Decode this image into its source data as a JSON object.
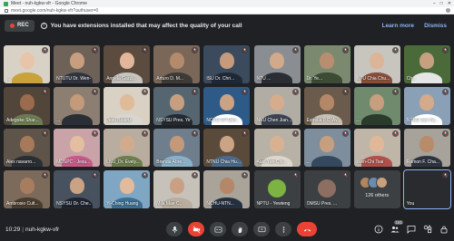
{
  "browser": {
    "title": "Meet - nuh-kgkw-vfr - Google Chrome",
    "url": "meet.google.com/nuh-kgkw-vfr?authuser=0"
  },
  "banner": {
    "rec_label": "REC",
    "warning": "You have extensions installed that may affect the quality of your call",
    "learn_more": "Learn more",
    "dismiss": "Dismiss"
  },
  "participants": [
    {
      "name": "...",
      "face": "#e8c4a8",
      "bg": "#d8d2c6",
      "body": "#c9a23b"
    },
    {
      "name": "NTUTU Dr. Wen-...",
      "face": "#c79e80",
      "bg": "#6e6258",
      "body": "#2f3440"
    },
    {
      "name": "Angela Garzi...",
      "face": "#e2b69a",
      "bg": "#5b4c3f",
      "body": "#c7c3bd"
    },
    {
      "name": "Arturo D. M...",
      "face": "#b38a6c",
      "bg": "#7a6757",
      "body": "#3e3a36"
    },
    {
      "name": "ISU Dr. Chri...",
      "face": "#c69a7c",
      "bg": "#3b4a5c",
      "body": "#1f2835"
    },
    {
      "name": "NTU ...",
      "face": "#d1a98b",
      "bg": "#8a8d91",
      "body": "#2a2d33"
    },
    {
      "name": "Dr. Ye...",
      "face": "#b98e70",
      "bg": "#7b8a6e",
      "body": "#3c4b33"
    },
    {
      "name": "NTU Chia Chu...",
      "face": "#dcb498",
      "bg": "#c8c5bf",
      "body": "#8a4d3a"
    },
    {
      "name": "Ch...",
      "face": "#c7a080",
      "bg": "#4a6a3a",
      "body": "#e6e6e6"
    },
    {
      "name": "Adegoke Shar...",
      "face": "#9a6b4c",
      "bg": "#52463a",
      "body": "#6c7b53"
    },
    {
      "name": "...",
      "face": "#c39a7a",
      "bg": "#8c7f72",
      "body": "#2a2e35"
    },
    {
      "name": "Jesu Beatriz",
      "face": "#e0bb9a",
      "bg": "#d9d1c4",
      "body": "#d9d6cf"
    },
    {
      "name": "NSYSU Pres. Yin...",
      "face": "#c79f80",
      "bg": "#556670",
      "body": "#242a31"
    },
    {
      "name": "NCYU VP Den...",
      "face": "#caa284",
      "bg": "#2e5a88",
      "body": "#ffffff"
    },
    {
      "name": "NKU Chen Jian...",
      "face": "#d5ac8c",
      "bg": "#b1aca4",
      "body": "#3b4350"
    },
    {
      "name": "Estrella P.C. Ay...",
      "face": "#b48867",
      "bg": "#6a5b4c",
      "body": "#c8bfb3"
    },
    {
      "name": "...",
      "face": "#c79e7e",
      "bg": "#6f8a6c",
      "body": "#2a3a2b"
    },
    {
      "name": "NTNU Jun-Ya...",
      "face": "#d3aa8a",
      "bg": "#8aa0b6",
      "body": "#ffffff"
    },
    {
      "name": "Alex navarro...",
      "face": "#a5795a",
      "bg": "#5e544a",
      "body": "#2b2e33"
    },
    {
      "name": "MDSPC - Jesu...",
      "face": "#e3bea0",
      "bg": "#c9a3a8",
      "body": "#c45a88"
    },
    {
      "name": "LNU_Dr. Evely...",
      "face": "#d2ab8f",
      "bg": "#b8ad9e",
      "body": "#6d7d4e"
    },
    {
      "name": "Brenda Abre...",
      "face": "#c4997a",
      "bg": "#6f7e8d",
      "body": "#8ab0c8"
    },
    {
      "name": "NTNU Chia Hu...",
      "face": "#cba385",
      "bg": "#5a4a3a",
      "body": "#4b6a8a"
    },
    {
      "name": "Alan Yen-Chi...",
      "face": "#d8b193",
      "bg": "#b7b1a6",
      "body": "#dcd6cc"
    },
    {
      "name": "...",
      "face": "#c69f7f",
      "bg": "#7f8e9c",
      "body": "#34495e"
    },
    {
      "name": "Wen-Chi Tsai",
      "face": "#e0b898",
      "bg": "#c0b6a8",
      "body": "#b0504a"
    },
    {
      "name": "Ramon F. Cha...",
      "face": "#b88b6a",
      "bg": "#a7a29a",
      "body": "#2d3440"
    },
    {
      "name": "Ambrosio Cult...",
      "face": "#a87c5e",
      "bg": "#7c6b5a",
      "body": "#4a3c2e"
    },
    {
      "name": "NSYSU Dr. Che...",
      "face": "#caa385",
      "bg": "#47525e",
      "body": "#1f2530"
    },
    {
      "name": "Yi-Ching Huang",
      "face": "#e1bb9c",
      "bg": "#7fa7c4",
      "body": "#3d6f93"
    },
    {
      "name": "Mila Mae C...",
      "face": "#c9a083",
      "bg": "#c6c2ba",
      "body": "#b9ad9d"
    },
    {
      "name": "NCHU-NTN...",
      "face": "#b48768",
      "bg": "#a9a39a",
      "body": "#243040"
    }
  ],
  "avatar_tiles": [
    {
      "name": "NPTU - Yewteng ...",
      "color": "#7cb342"
    },
    {
      "name": "OMSU Pres. ...",
      "color": "#8d6e63"
    }
  ],
  "others": {
    "label": "126 others"
  },
  "self": {
    "name": "You"
  },
  "bottom": {
    "time": "10:29",
    "meeting_code": "nuh-kgkw-vfr",
    "participant_count": "161"
  }
}
